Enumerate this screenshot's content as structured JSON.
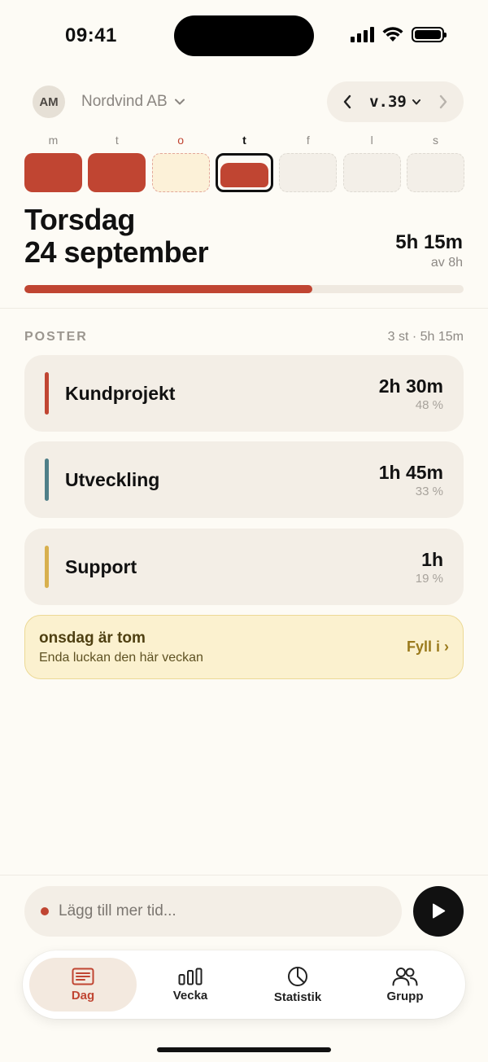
{
  "status_bar": {
    "time": "09:41"
  },
  "header": {
    "avatar_initials": "AM",
    "company": "Nordvind AB",
    "week": "v.39"
  },
  "week_days": [
    {
      "letter": "m",
      "state": "full"
    },
    {
      "letter": "t",
      "state": "full"
    },
    {
      "letter": "o",
      "state": "empty-warn"
    },
    {
      "letter": "t",
      "state": "selected"
    },
    {
      "letter": "f",
      "state": "future"
    },
    {
      "letter": "l",
      "state": "future"
    },
    {
      "letter": "s",
      "state": "future"
    }
  ],
  "day": {
    "weekday": "Torsdag",
    "date": "24 september",
    "total": "5h 15m",
    "target": "av 8h",
    "progress_fraction": 0.656
  },
  "entries_section": {
    "title": "POSTER",
    "meta": "3 st · 5h 15m",
    "items": [
      {
        "label": "Kundprojekt",
        "time": "2h 30m",
        "percent": "48 %",
        "color": "#c04532"
      },
      {
        "label": "Utveckling",
        "time": "1h 45m",
        "percent": "33 %",
        "color": "#4f7f88"
      },
      {
        "label": "Support",
        "time": "1h",
        "percent": "19 %",
        "color": "#d8b04e"
      }
    ]
  },
  "notice": {
    "title": "onsdag är tom",
    "subtitle": "Enda luckan den här veckan",
    "action": "Fyll i ›"
  },
  "composer": {
    "placeholder": "Lägg till mer tid..."
  },
  "tabs": [
    {
      "label": "Dag",
      "icon": "day-list-icon",
      "active": true
    },
    {
      "label": "Vecka",
      "icon": "week-bars-icon",
      "active": false
    },
    {
      "label": "Statistik",
      "icon": "pie-chart-icon",
      "active": false
    },
    {
      "label": "Grupp",
      "icon": "group-icon",
      "active": false
    }
  ],
  "colors": {
    "accent": "#c04532",
    "background": "#fdfbf5",
    "card": "#f3eee6"
  }
}
